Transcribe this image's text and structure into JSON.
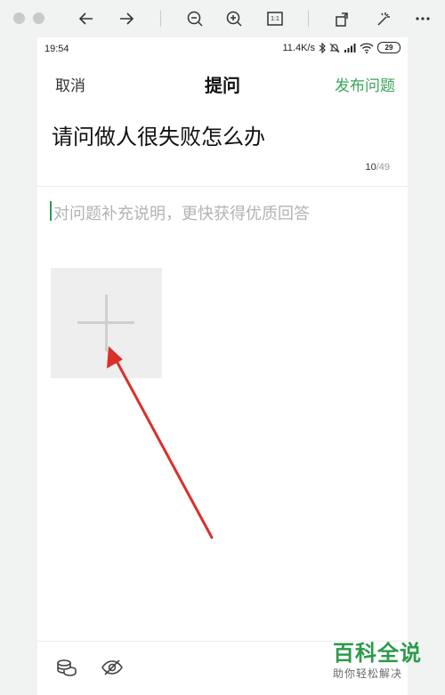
{
  "viewer": {
    "toolbar_icons": [
      "close-circle-icon",
      "blocked-circle-icon",
      "arrow-left-icon",
      "arrow-right-icon",
      "zoom-out-icon",
      "zoom-in-icon",
      "actual-size-icon",
      "rotate-icon",
      "magic-wand-icon",
      "more-icon"
    ],
    "actual_size_label": "1:1"
  },
  "status_bar": {
    "time": "19:54",
    "speed": "11.4K/s",
    "battery": "29"
  },
  "nav": {
    "cancel": "取消",
    "title": "提问",
    "publish": "发布问题",
    "publish_color": "#3aa55a"
  },
  "question": {
    "title": "请问做人很失败怎么办",
    "count_current": "10",
    "count_max": "/49",
    "description_placeholder": "对问题补充说明，更快获得优质回答"
  },
  "bottom_toolbar": {
    "icons": [
      "coins-icon",
      "eye-off-icon"
    ]
  },
  "watermark": {
    "main": "百科全说",
    "sub": "助你轻松解决",
    "color": "#2c9a4b"
  },
  "annotation": {
    "arrow_color": "#d9302c"
  }
}
